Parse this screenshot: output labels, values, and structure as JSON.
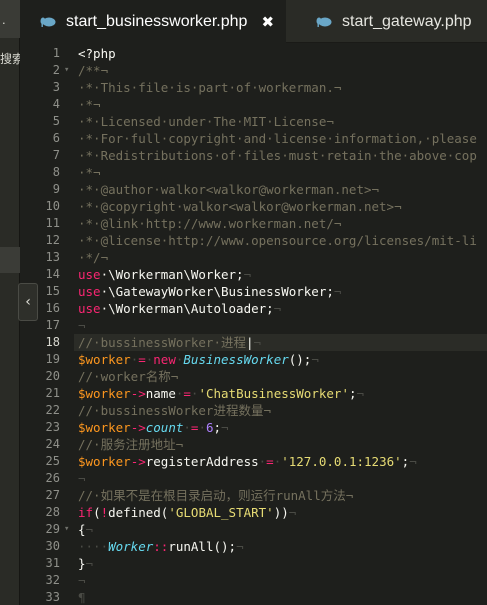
{
  "sidebar": {
    "top_text": ".",
    "search_label": "搜索",
    "collapse_glyph": "‹"
  },
  "tabs": [
    {
      "label": "start_businessworker.php",
      "active": true,
      "close_glyph": "✖",
      "icon": "elephant-php-icon"
    },
    {
      "label": "start_gateway.php",
      "active": false,
      "icon": "elephant-php-icon"
    }
  ],
  "editor": {
    "current_line": 18,
    "lines": [
      {
        "n": "1",
        "fold": "",
        "tokens": [
          [
            "pl",
            "<?php"
          ]
        ]
      },
      {
        "n": "2",
        "fold": "▾",
        "tokens": [
          [
            "cm",
            "/**¬"
          ]
        ]
      },
      {
        "n": "3",
        "fold": "",
        "tokens": [
          [
            "cm",
            "·*·This·file·is·part·of·workerman.¬"
          ]
        ]
      },
      {
        "n": "4",
        "fold": "",
        "tokens": [
          [
            "cm",
            "·*¬"
          ]
        ]
      },
      {
        "n": "5",
        "fold": "",
        "tokens": [
          [
            "cm",
            "·*·Licensed·under·The·MIT·License¬"
          ]
        ]
      },
      {
        "n": "6",
        "fold": "",
        "tokens": [
          [
            "cm",
            "·*·For·full·copyright·and·license·information,·please"
          ]
        ]
      },
      {
        "n": "7",
        "fold": "",
        "tokens": [
          [
            "cm",
            "·*·Redistributions·of·files·must·retain·the·above·cop"
          ]
        ]
      },
      {
        "n": "8",
        "fold": "",
        "tokens": [
          [
            "cm",
            "·*¬"
          ]
        ]
      },
      {
        "n": "9",
        "fold": "",
        "tokens": [
          [
            "cm",
            "·*·@author·walkor<walkor@workerman.net>¬"
          ]
        ]
      },
      {
        "n": "10",
        "fold": "",
        "tokens": [
          [
            "cm",
            "·*·@copyright·walkor<walkor@workerman.net>¬"
          ]
        ]
      },
      {
        "n": "11",
        "fold": "",
        "tokens": [
          [
            "cm",
            "·*·@link·http://www.workerman.net/¬"
          ]
        ]
      },
      {
        "n": "12",
        "fold": "",
        "tokens": [
          [
            "cm",
            "·*·@license·http://www.opensource.org/licenses/mit-li"
          ]
        ]
      },
      {
        "n": "13",
        "fold": "",
        "tokens": [
          [
            "cm",
            "·*/¬"
          ]
        ]
      },
      {
        "n": "14",
        "fold": "",
        "tokens": [
          [
            "kw",
            "use"
          ],
          [
            "pl",
            "·\\Workerman\\Worker;"
          ],
          [
            "ws",
            "¬"
          ]
        ]
      },
      {
        "n": "15",
        "fold": "",
        "tokens": [
          [
            "kw",
            "use"
          ],
          [
            "pl",
            "·\\GatewayWorker\\BusinessWorker;"
          ],
          [
            "ws",
            "¬"
          ]
        ]
      },
      {
        "n": "16",
        "fold": "",
        "tokens": [
          [
            "kw",
            "use"
          ],
          [
            "pl",
            "·\\Workerman\\Autoloader;"
          ],
          [
            "ws",
            "¬"
          ]
        ]
      },
      {
        "n": "17",
        "fold": "",
        "tokens": [
          [
            "ws",
            "¬"
          ]
        ]
      },
      {
        "n": "18",
        "fold": "",
        "tokens": [
          [
            "cm",
            "//·bussinessWorker·进程"
          ],
          [
            "pl",
            "|"
          ],
          [
            "ws",
            "¬"
          ]
        ]
      },
      {
        "n": "19",
        "fold": "",
        "tokens": [
          [
            "var",
            "$worker"
          ],
          [
            "ws",
            "·"
          ],
          [
            "kw",
            "="
          ],
          [
            "ws",
            "·"
          ],
          [
            "kw",
            "new"
          ],
          [
            "ws",
            "·"
          ],
          [
            "cls",
            "BusinessWorker"
          ],
          [
            "pl",
            "();"
          ],
          [
            "ws",
            "¬"
          ]
        ]
      },
      {
        "n": "20",
        "fold": "",
        "tokens": [
          [
            "cm",
            "//·worker名称¬"
          ]
        ]
      },
      {
        "n": "21",
        "fold": "",
        "tokens": [
          [
            "var",
            "$worker"
          ],
          [
            "kw",
            "->"
          ],
          [
            "pl",
            "name"
          ],
          [
            "ws",
            "·"
          ],
          [
            "kw",
            "="
          ],
          [
            "ws",
            "·"
          ],
          [
            "str",
            "'ChatBusinessWorker'"
          ],
          [
            "pl",
            ";"
          ],
          [
            "ws",
            "¬"
          ]
        ]
      },
      {
        "n": "22",
        "fold": "",
        "tokens": [
          [
            "cm",
            "//·bussinessWorker进程数量¬"
          ]
        ]
      },
      {
        "n": "23",
        "fold": "",
        "tokens": [
          [
            "var",
            "$worker"
          ],
          [
            "kw",
            "->"
          ],
          [
            "cls",
            "count"
          ],
          [
            "ws",
            "·"
          ],
          [
            "kw",
            "="
          ],
          [
            "ws",
            "·"
          ],
          [
            "num",
            "6"
          ],
          [
            "pl",
            ";"
          ],
          [
            "ws",
            "¬"
          ]
        ]
      },
      {
        "n": "24",
        "fold": "",
        "tokens": [
          [
            "cm",
            "//·服务注册地址¬"
          ]
        ]
      },
      {
        "n": "25",
        "fold": "",
        "tokens": [
          [
            "var",
            "$worker"
          ],
          [
            "kw",
            "->"
          ],
          [
            "pl",
            "registerAddress"
          ],
          [
            "ws",
            "·"
          ],
          [
            "kw",
            "="
          ],
          [
            "ws",
            "·"
          ],
          [
            "str",
            "'127.0.0.1:1236'"
          ],
          [
            "pl",
            ";"
          ],
          [
            "ws",
            "¬"
          ]
        ]
      },
      {
        "n": "26",
        "fold": "",
        "tokens": [
          [
            "ws",
            "¬"
          ]
        ]
      },
      {
        "n": "27",
        "fold": "",
        "tokens": [
          [
            "cm",
            "//·如果不是在根目录启动，则运行runAll方法¬"
          ]
        ]
      },
      {
        "n": "28",
        "fold": "",
        "tokens": [
          [
            "kw",
            "if"
          ],
          [
            "pl",
            "("
          ],
          [
            "kw",
            "!"
          ],
          [
            "pl",
            "defined("
          ],
          [
            "str",
            "'GLOBAL_START'"
          ],
          [
            "pl",
            "))"
          ],
          [
            "ws",
            "¬"
          ]
        ]
      },
      {
        "n": "29",
        "fold": "▾",
        "tokens": [
          [
            "pl",
            "{"
          ],
          [
            "ws",
            "¬"
          ]
        ]
      },
      {
        "n": "30",
        "fold": "",
        "tokens": [
          [
            "ws",
            "····"
          ],
          [
            "cls",
            "Worker"
          ],
          [
            "kw",
            "::"
          ],
          [
            "pl",
            "runAll();"
          ],
          [
            "ws",
            "¬"
          ]
        ]
      },
      {
        "n": "31",
        "fold": "",
        "tokens": [
          [
            "pl",
            "}"
          ],
          [
            "ws",
            "¬"
          ]
        ]
      },
      {
        "n": "32",
        "fold": "",
        "tokens": [
          [
            "ws",
            "¬"
          ]
        ]
      },
      {
        "n": "33",
        "fold": "",
        "tokens": [
          [
            "ws",
            "¶"
          ]
        ]
      }
    ]
  }
}
